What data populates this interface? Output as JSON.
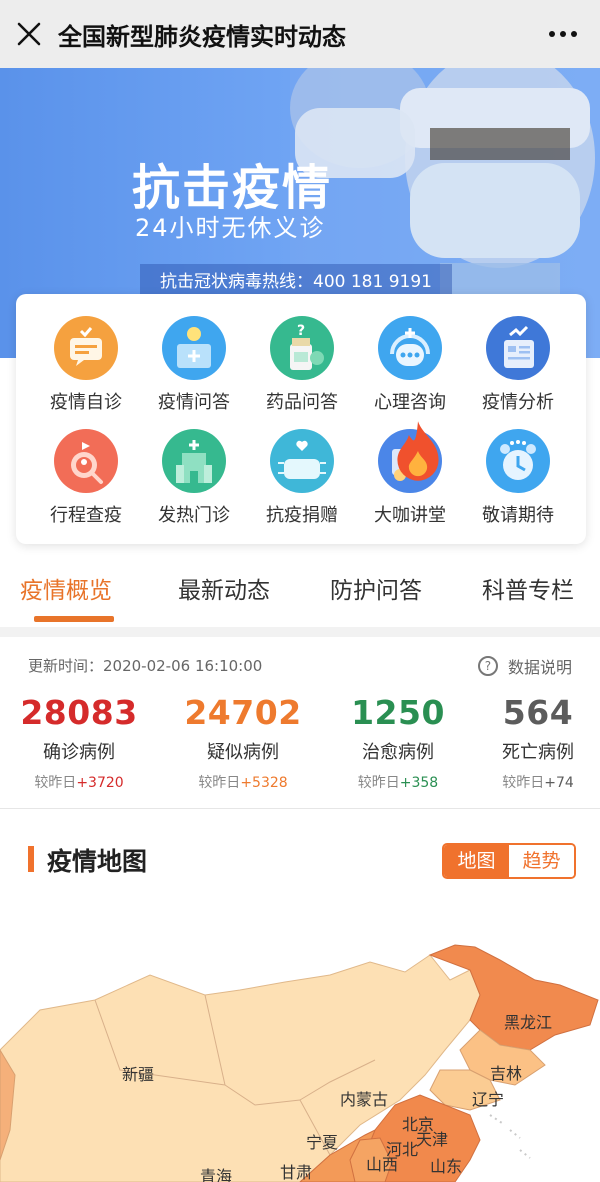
{
  "topbar": {
    "title": "全国新型肺炎疫情实时动态",
    "close_icon": "close-icon",
    "more_icon": "more-dots-icon"
  },
  "banner": {
    "title": "抗击疫情",
    "subtitle": "24小时无休义诊",
    "hotline": "抗击冠状病毒热线：400 181 9191"
  },
  "services": [
    {
      "label": "疫情自诊",
      "icon": "chat-bubble-icon",
      "color": "#f5a13f"
    },
    {
      "label": "疫情问答",
      "icon": "lightbulb-icon",
      "color": "#3fa6ef"
    },
    {
      "label": "药品问答",
      "icon": "medicine-bottle-icon",
      "color": "#36b98f"
    },
    {
      "label": "心理咨询",
      "icon": "headset-icon",
      "color": "#3fa6ef"
    },
    {
      "label": "疫情分析",
      "icon": "report-chart-icon",
      "color": "#3f78d8"
    },
    {
      "label": "行程查疫",
      "icon": "travel-search-icon",
      "color": "#f26d57"
    },
    {
      "label": "发热门诊",
      "icon": "hospital-icon",
      "color": "#36b98f"
    },
    {
      "label": "抗疫捐赠",
      "icon": "mask-heart-icon",
      "color": "#3fb7d8"
    },
    {
      "label": "大咖讲堂",
      "icon": "video-lecture-icon",
      "color": "#4b86e8",
      "hot": true
    },
    {
      "label": "敬请期待",
      "icon": "alarm-clock-icon",
      "color": "#3fa6ef"
    }
  ],
  "tabs": [
    {
      "label": "疫情概览",
      "active": true
    },
    {
      "label": "最新动态",
      "active": false
    },
    {
      "label": "防护问答",
      "active": false
    },
    {
      "label": "科普专栏",
      "active": false
    }
  ],
  "stats": {
    "updated": "更新时间：2020-02-06 16:10:00",
    "data_note": "数据说明",
    "items": [
      {
        "value": "28083",
        "label": "确诊病例",
        "delta_prefix": "较昨日",
        "delta": "+3720",
        "color": "#d52b2b"
      },
      {
        "value": "24702",
        "label": "疑似病例",
        "delta_prefix": "较昨日",
        "delta": "+5328",
        "color": "#ee7a2e"
      },
      {
        "value": "1250",
        "label": "治愈病例",
        "delta_prefix": "较昨日",
        "delta": "+358",
        "color": "#2a8f52"
      },
      {
        "value": "564",
        "label": "死亡病例",
        "delta_prefix": "较昨日",
        "delta": "+74",
        "color": "#5c5c5c"
      }
    ]
  },
  "map_section": {
    "title": "疫情地图",
    "toggle_map": "地图",
    "toggle_trend": "趋势",
    "regions": [
      "黑龙江",
      "吉林",
      "新疆",
      "内蒙古",
      "辽宁",
      "北京",
      "天津",
      "宁夏",
      "河北",
      "山西",
      "山东",
      "青海",
      "甘肃"
    ]
  }
}
